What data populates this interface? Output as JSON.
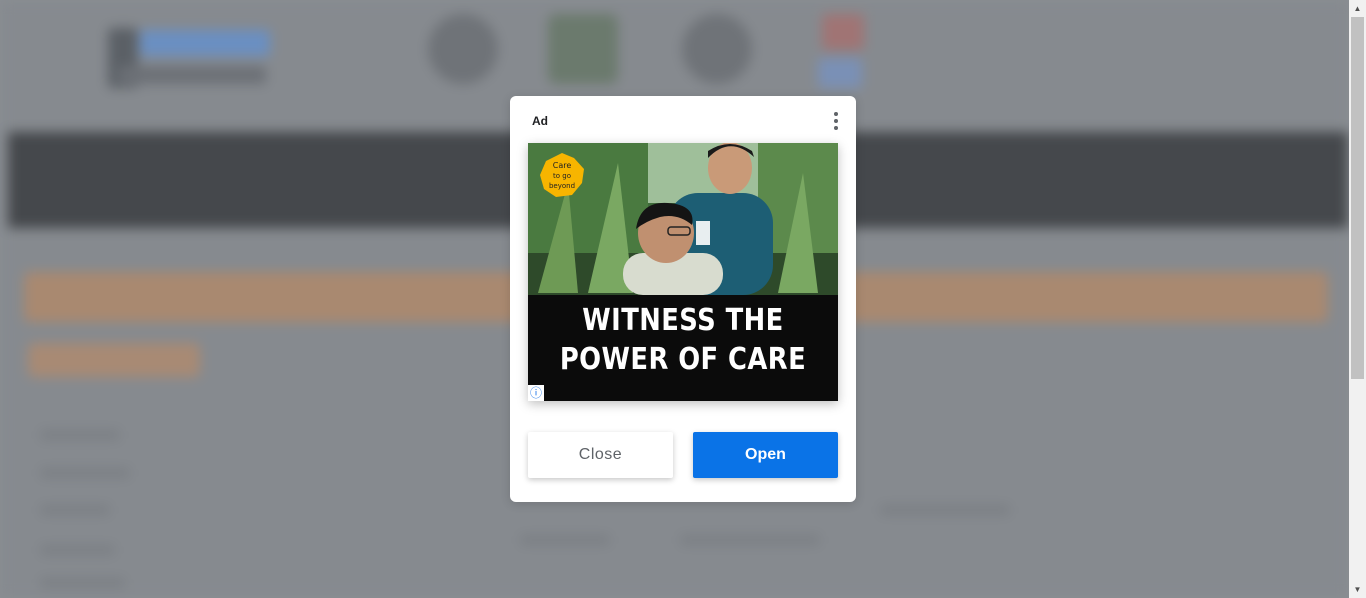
{
  "ad": {
    "label": "Ad",
    "headline_line1": "WITNESS THE",
    "headline_line2": "POWER OF CARE",
    "badge_text": [
      "Care",
      "to go",
      "beyond"
    ],
    "adchoices_icon": "info-icon",
    "menu_icon": "kebab-menu-icon"
  },
  "buttons": {
    "close_label": "Close",
    "open_label": "Open"
  },
  "colors": {
    "open_button": "#0a73e7",
    "overlay": "#8a8e93",
    "badge": "#f7b500"
  }
}
